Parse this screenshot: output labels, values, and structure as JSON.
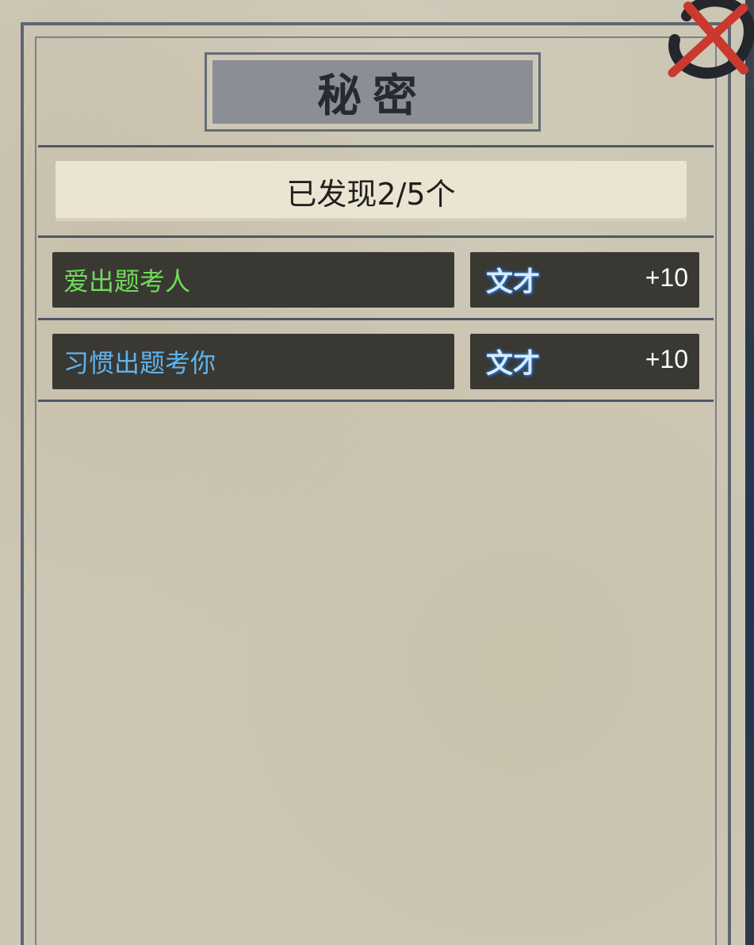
{
  "panel": {
    "title": "秘密",
    "discovered_text": "已发现2/5个"
  },
  "secrets": [
    {
      "name": "爱出题考人",
      "name_color": "#6fdc5a",
      "reward_label": "文才",
      "reward_value": "+10"
    },
    {
      "name": "习惯出题考你",
      "name_color": "#5eb4ee",
      "reward_label": "文才",
      "reward_value": "+10"
    }
  ],
  "close_icon": "close-icon"
}
